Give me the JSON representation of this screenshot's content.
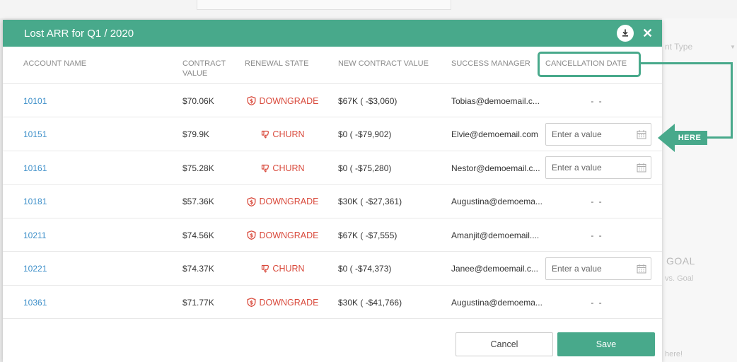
{
  "background": {
    "field_fragment": "nt Type",
    "goal_fragment": "GOAL",
    "vs_fragment": "vs. Goal",
    "here_fragment": "here!"
  },
  "modal": {
    "title": "Lost ARR for Q1 / 2020",
    "download_icon": "download-icon",
    "close_icon": "close-icon",
    "columns": {
      "account_name": "ACCOUNT NAME",
      "contract_value_1": "CONTRACT",
      "contract_value_2": "VALUE",
      "renewal_state": "RENEWAL STATE",
      "new_contract_value": "NEW CONTRACT VALUE",
      "success_manager": "SUCCESS MANAGER",
      "cancellation_date": "CANCELLATION DATE"
    },
    "rows": [
      {
        "account": "10101",
        "contract": "$70.06K",
        "state": "DOWNGRADE",
        "state_icon": "downgrade-icon",
        "new_value": "$67K ( -$3,060)",
        "manager": "Tobias@demoemail.c...",
        "cancel": "- -",
        "has_input": false
      },
      {
        "account": "10151",
        "contract": "$79.9K",
        "state": "CHURN",
        "state_icon": "thumbs-down-icon",
        "new_value": "$0 ( -$79,902)",
        "manager": "Elvie@demoemail.com",
        "cancel": "",
        "has_input": true
      },
      {
        "account": "10161",
        "contract": "$75.28K",
        "state": "CHURN",
        "state_icon": "thumbs-down-icon",
        "new_value": "$0 ( -$75,280)",
        "manager": "Nestor@demoemail.c...",
        "cancel": "",
        "has_input": true
      },
      {
        "account": "10181",
        "contract": "$57.36K",
        "state": "DOWNGRADE",
        "state_icon": "downgrade-icon",
        "new_value": "$30K ( -$27,361)",
        "manager": "Augustina@demoema...",
        "cancel": "- -",
        "has_input": false
      },
      {
        "account": "10211",
        "contract": "$74.56K",
        "state": "DOWNGRADE",
        "state_icon": "downgrade-icon",
        "new_value": "$67K ( -$7,555)",
        "manager": "Amanjit@demoemail....",
        "cancel": "- -",
        "has_input": false
      },
      {
        "account": "10221",
        "contract": "$74.37K",
        "state": "CHURN",
        "state_icon": "thumbs-down-icon",
        "new_value": "$0 ( -$74,373)",
        "manager": "Janee@demoemail.c...",
        "cancel": "",
        "has_input": true
      },
      {
        "account": "10361",
        "contract": "$71.77K",
        "state": "DOWNGRADE",
        "state_icon": "downgrade-icon",
        "new_value": "$30K ( -$41,766)",
        "manager": "Augustina@demoema...",
        "cancel": "- -",
        "has_input": false
      }
    ],
    "date_placeholder": "Enter a value",
    "cancel_label": "Cancel",
    "save_label": "Save"
  },
  "annotation": {
    "label": "HERE"
  },
  "colors": {
    "accent": "#48a98b",
    "link": "#3d8fc9",
    "state_red": "#d94a3c"
  }
}
